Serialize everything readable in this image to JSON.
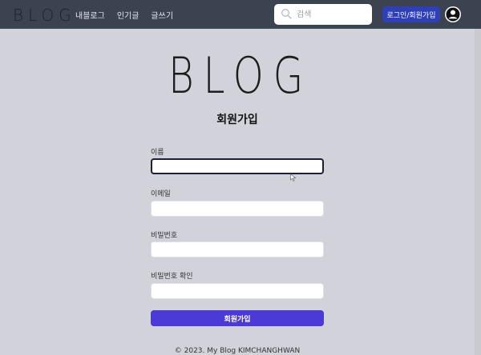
{
  "navbar": {
    "logo": "BLOG",
    "links": [
      {
        "label": "내블로그"
      },
      {
        "label": "인기글"
      },
      {
        "label": "글쓰기"
      }
    ],
    "search": {
      "placeholder": "검색",
      "value": "",
      "icon": "search-icon"
    },
    "login_label": "로그인/회원가입",
    "avatar_icon": "user-avatar-icon"
  },
  "main": {
    "logo": "BLOG",
    "title": "회원가입",
    "fields": [
      {
        "label": "이름",
        "value": ""
      },
      {
        "label": "이메일",
        "value": ""
      },
      {
        "label": "비밀번호",
        "value": ""
      },
      {
        "label": "비밀번호 확인",
        "value": ""
      }
    ],
    "submit_label": "회원가입"
  },
  "footer": {
    "text": "© 2023. My Blog KIMCHANGHWAN"
  },
  "colors": {
    "navbar_bg": "#3b4350",
    "page_bg": "#d2d3da",
    "login_button": "#2e3fb8",
    "submit_button": "#4b3ad6"
  }
}
